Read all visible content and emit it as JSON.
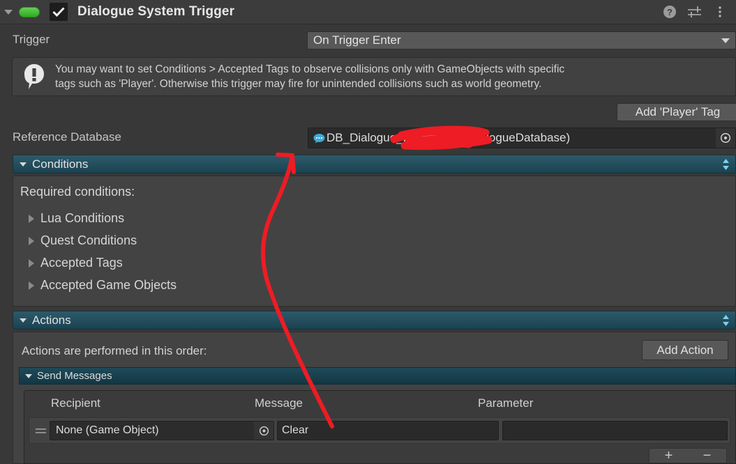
{
  "component": {
    "title": "Dialogue System Trigger",
    "enabled_checkbox": true,
    "script_icon": "unity-script-icon",
    "help_icon": "help-icon",
    "preset_icon": "preset-sliders-icon",
    "menu_icon": "three-dot-menu-icon",
    "foldout_expanded": true
  },
  "trigger": {
    "label": "Trigger",
    "value": "On Trigger Enter"
  },
  "help": {
    "icon": "warning-exclamation-icon",
    "line1": "You may want to set Conditions > Accepted Tags to observe collisions only with GameObjects with specific",
    "line2": "tags such as 'Player'. Otherwise this trigger may fire for unintended collisions such as world geometry."
  },
  "add_player_tag_button": "Add 'Player' Tag",
  "reference_database": {
    "label": "Reference Database",
    "value": "DB_Dialogue_E██████ (DialogueDatabase)",
    "icon": "dialogue-database-icon",
    "picker_icon": "object-picker-icon"
  },
  "conditions": {
    "header": "Conditions",
    "expanded": true,
    "required_label": "Required conditions:",
    "items": [
      {
        "label": "Lua Conditions",
        "expanded": false
      },
      {
        "label": "Quest Conditions",
        "expanded": false
      },
      {
        "label": "Accepted Tags",
        "expanded": false
      },
      {
        "label": "Accepted Game Objects",
        "expanded": false
      }
    ]
  },
  "actions": {
    "header": "Actions",
    "expanded": true,
    "order_label": "Actions are performed in this order:",
    "add_action_button": "Add Action",
    "send_messages": {
      "header": "Send Messages",
      "expanded": true,
      "columns": [
        "Recipient",
        "Message",
        "Parameter"
      ],
      "rows": [
        {
          "recipient": "None (Game Object)",
          "message": "Clear",
          "parameter": ""
        }
      ],
      "add_row_button": "+",
      "remove_row_button": "−"
    }
  },
  "annotation": {
    "arrow_color": "#ee1c24",
    "redaction_color": "#ee1c24",
    "description": "red hand-drawn arrow from Message field up to Reference Database row, plus red scribble over part of database name"
  },
  "colors": {
    "background": "#383838",
    "header": "#3c3c3c",
    "section_teal": "#27546a",
    "panel": "#434343",
    "field": "#2a2a2a",
    "button": "#585858",
    "text": "#d6d6d6",
    "accent_green": "#4fbf3f"
  }
}
